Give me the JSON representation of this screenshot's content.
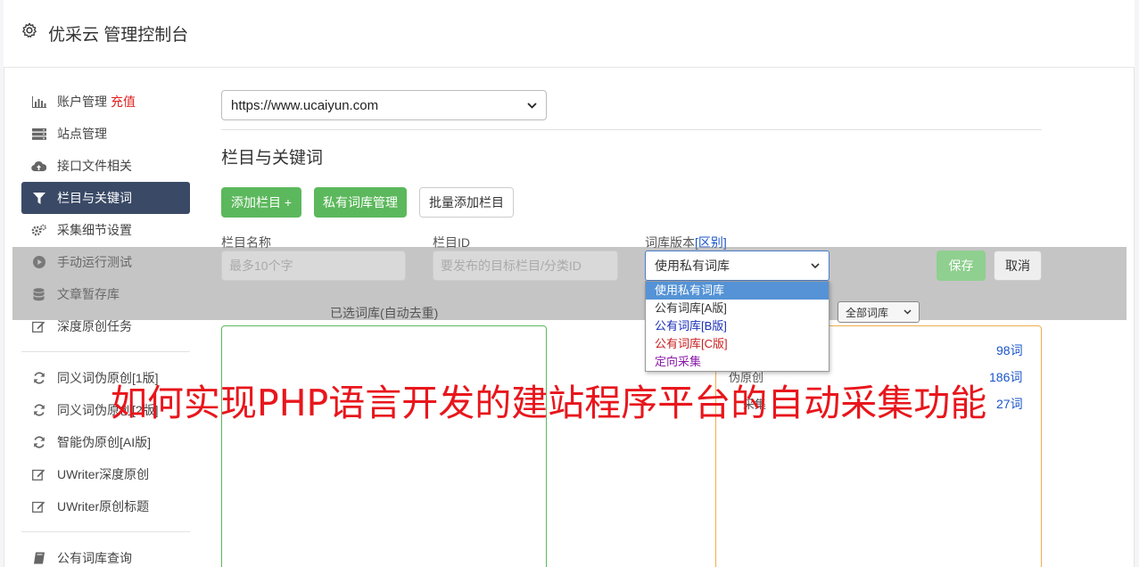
{
  "header": {
    "title": "优采云 管理控制台"
  },
  "sidebar": {
    "items": [
      {
        "label": "账户管理",
        "badge": "充值",
        "icon": "bar-chart-icon"
      },
      {
        "label": "站点管理",
        "icon": "server-icon"
      },
      {
        "label": "接口文件相关",
        "icon": "cloud-upload-icon"
      },
      {
        "label": "栏目与关键词",
        "icon": "filter-icon",
        "active": true
      },
      {
        "label": "采集细节设置",
        "icon": "gears-icon"
      },
      {
        "label": "手动运行测试",
        "icon": "play-icon"
      },
      {
        "label": "文章暂存库",
        "icon": "database-icon"
      },
      {
        "label": "深度原创任务",
        "icon": "edit-icon"
      },
      {
        "label": "同义词伪原创[1版]",
        "icon": "refresh-icon"
      },
      {
        "label": "同义词伪原创[2版]",
        "icon": "refresh-icon"
      },
      {
        "label": "智能伪原创[AI版]",
        "icon": "refresh-icon"
      },
      {
        "label": "UWriter深度原创",
        "icon": "edit-icon"
      },
      {
        "label": "UWriter原创标题",
        "icon": "edit-icon"
      },
      {
        "label": "公有词库查询",
        "icon": "book-icon"
      }
    ]
  },
  "main": {
    "site_select": "https://www.ucaiyun.com",
    "section_title": "栏目与关键词",
    "buttons": {
      "add_column": "添加栏目 +",
      "private_lib": "私有词库管理",
      "batch_add": "批量添加栏目"
    },
    "form": {
      "name_label": "栏目名称",
      "name_placeholder": "最多10个字",
      "id_label": "栏目ID",
      "id_placeholder": "要发布的目标栏目/分类ID",
      "version_label": "词库版本",
      "version_diff": "[区别]",
      "version_value": "使用私有词库",
      "save": "保存",
      "cancel": "取消"
    },
    "dropdown_options": [
      {
        "label": "使用私有词库",
        "color": "#ffffff",
        "selected": true
      },
      {
        "label": "公有词库[A版]",
        "color": "#333333"
      },
      {
        "label": "公有词库[B版]",
        "color": "#1a2fb8"
      },
      {
        "label": "公有词库[C版]",
        "color": "#c81e1e"
      },
      {
        "label": "定向采集",
        "color": "#8a1aa8"
      }
    ],
    "selected_label": "已选词库(自动去重)",
    "filter_select": "全部词库",
    "library_counts": [
      "98词",
      "186词",
      "27词"
    ],
    "library_names": [
      "伪原创",
      "采集"
    ]
  },
  "watermark": "如何实现PHP语言开发的建站程序平台的自动采集功能",
  "colors": {
    "accent_green": "#5cb85c",
    "nav_active": "#3a4a66",
    "link_blue": "#1a55c8",
    "watermark_red": "#e8161c"
  }
}
